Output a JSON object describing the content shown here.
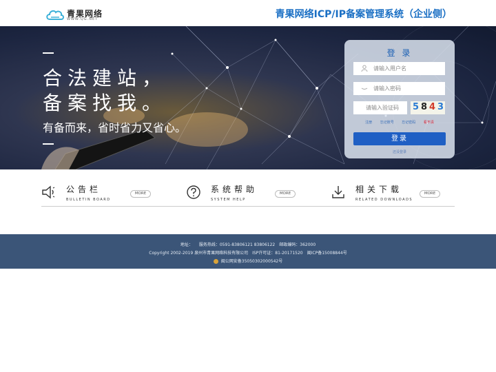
{
  "header": {
    "logo_cn": "青果网络",
    "logo_en": "WWW.QG.NET",
    "system_title": "青果网络ICP/IP备案管理系统（企业侧）"
  },
  "banner": {
    "slogan_line1": "合法建站，",
    "slogan_line2": "备案找我。",
    "slogan_line3": "有备而来，省时省力又省心。"
  },
  "login": {
    "title": "登 录",
    "username_placeholder": "请输入用户名",
    "password_placeholder": "请输入密码",
    "captcha_placeholder": "请输入验证码",
    "captcha_chars": [
      "5",
      "8",
      "4",
      "3"
    ],
    "captcha_colors": [
      "#2a7bd4",
      "#222222",
      "#d23b2b",
      "#2a7bd4"
    ],
    "links": [
      "注册",
      "忘记账号",
      "忘记密码",
      "看不清"
    ],
    "login_button": "登录",
    "register_link": "还没登录"
  },
  "sections": [
    {
      "icon": "speaker-icon",
      "title": "公告栏",
      "subtitle": "BULLETIN BOARD",
      "more": "MORE"
    },
    {
      "icon": "question-icon",
      "title": "系统帮助",
      "subtitle": "SYSTEM HELP",
      "more": "MORE"
    },
    {
      "icon": "download-icon",
      "title": "相关下载",
      "subtitle": "RELATED DOWNLOADS",
      "more": "MORE"
    }
  ],
  "footer": {
    "line1": "地址：　　服务热线：0591-83806121 83806122　邮政编码：362000",
    "line2": "Copyright 2002-2019 泉州市青果网络科技有限公司　ISP许可证：81-20171520　闽ICP备15008844号",
    "line3": "闽公网安备35050302000542号"
  },
  "colors": {
    "brand_blue": "#1a6fc4",
    "login_button": "#1f5fc4",
    "footer_bg": "#3b5578"
  }
}
